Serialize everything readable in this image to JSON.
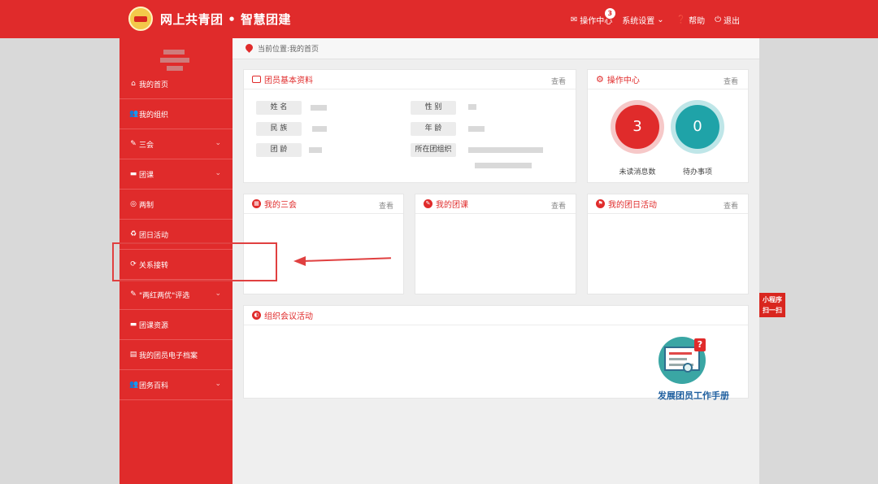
{
  "header": {
    "brand": "网上共青团 • 智慧团建",
    "nav": [
      {
        "label": "操作中心",
        "icon": "envelope-icon",
        "badge": "3"
      },
      {
        "label": "系统设置",
        "icon": "chevron-down-icon"
      },
      {
        "label": "帮助",
        "icon": "help-icon"
      },
      {
        "label": "退出",
        "icon": "power-icon"
      }
    ]
  },
  "sidebar": {
    "items": [
      {
        "label": "我的首页",
        "icon": "home-icon"
      },
      {
        "label": "我的组织",
        "icon": "users-icon"
      },
      {
        "label": "三会",
        "icon": "edit-icon",
        "expandable": true
      },
      {
        "label": "团课",
        "icon": "folder-icon",
        "expandable": true
      },
      {
        "label": "两制",
        "icon": "target-icon"
      },
      {
        "label": "团日活动",
        "icon": "recycle-icon"
      },
      {
        "label": "关系接转",
        "icon": "refresh-icon"
      },
      {
        "label": "\"两红两优\"评选",
        "icon": "edit-icon",
        "expandable": true
      },
      {
        "label": "团课资源",
        "icon": "folder-icon"
      },
      {
        "label": "我的团员电子档案",
        "icon": "file-icon"
      },
      {
        "label": "团务百科",
        "icon": "users-icon",
        "expandable": true
      }
    ]
  },
  "breadcrumb": "当前位置:我的首页",
  "profile": {
    "title": "团员基本资料",
    "more": "查看",
    "fields": {
      "name": "姓 名",
      "gender": "性 别",
      "ethnicity": "民 族",
      "age": "年 龄",
      "league_age": "团 龄",
      "branch": "所在团组织"
    }
  },
  "ops": {
    "title": "操作中心",
    "more": "查看",
    "unread_count": "3",
    "unread_label": "未读消息数",
    "todo_count": "0",
    "todo_label": "待办事项"
  },
  "panels": {
    "sanhui": {
      "title": "我的三会",
      "more": "查看"
    },
    "tuanke": {
      "title": "我的团课",
      "more": "查看"
    },
    "tuanri": {
      "title": "我的团日活动",
      "more": "查看"
    },
    "meeting": {
      "title": "组织会议活动"
    }
  },
  "handbook": {
    "label": "发展团员工作手册"
  },
  "float": {
    "line1": "小程序",
    "line2": "扫一扫"
  },
  "colors": {
    "primary": "#e02b2b",
    "teal": "#1fa3a8"
  }
}
